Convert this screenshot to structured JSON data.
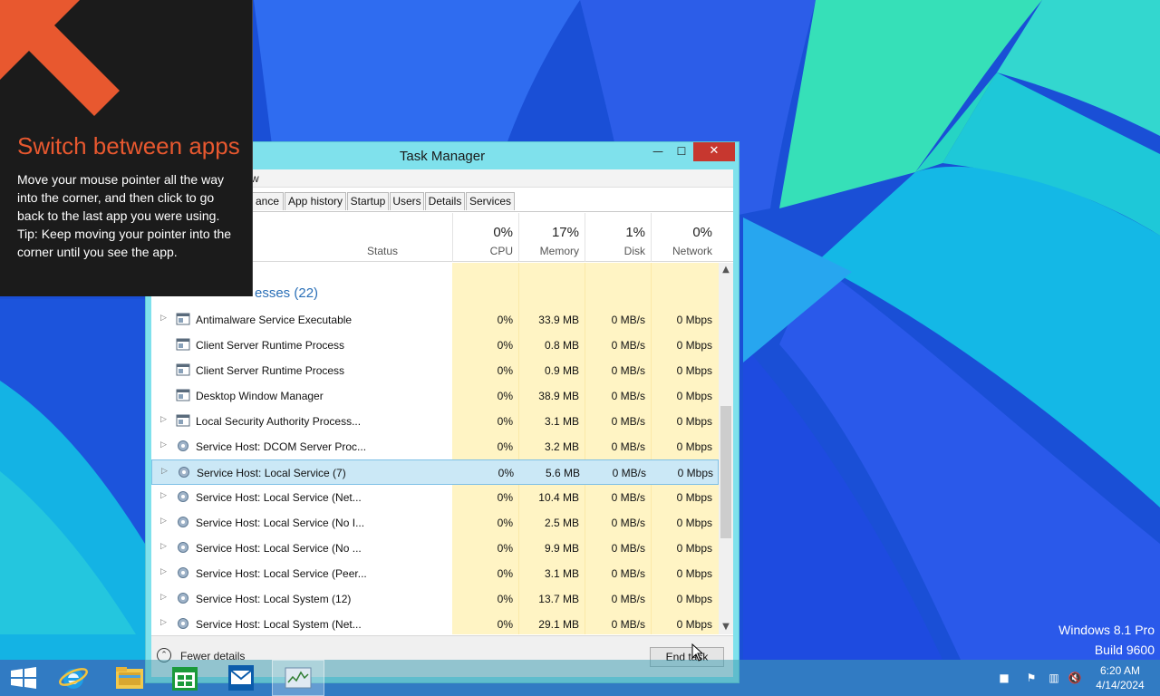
{
  "tip": {
    "title": "Switch between apps",
    "body_line1": "Move your mouse pointer all the way into the corner, and then click to go back to the last app you were using.",
    "body_line2": "Tip: Keep moving your pointer into the corner until you see the app.",
    "accent_color": "#e8582f"
  },
  "task_manager": {
    "title": "Task Manager",
    "menu_view": "w",
    "tabs": [
      "ance",
      "App history",
      "Startup",
      "Users",
      "Details",
      "Services"
    ],
    "columns": {
      "status": "Status",
      "cpu_pct": "0%",
      "cpu": "CPU",
      "memory_pct": "17%",
      "memory": "Memory",
      "disk_pct": "1%",
      "disk": "Disk",
      "network_pct": "0%",
      "network": "Network"
    },
    "group_header": "esses (22)",
    "rows": [
      {
        "name": "Antimalware Service Executable",
        "cpu": "0%",
        "memory": "33.9 MB",
        "disk": "0 MB/s",
        "network": "0 Mbps",
        "expandable": true,
        "icon": "window-icon"
      },
      {
        "name": "Client Server Runtime Process",
        "cpu": "0%",
        "memory": "0.8 MB",
        "disk": "0 MB/s",
        "network": "0 Mbps",
        "expandable": false,
        "icon": "window-icon"
      },
      {
        "name": "Client Server Runtime Process",
        "cpu": "0%",
        "memory": "0.9 MB",
        "disk": "0 MB/s",
        "network": "0 Mbps",
        "expandable": false,
        "icon": "window-icon"
      },
      {
        "name": "Desktop Window Manager",
        "cpu": "0%",
        "memory": "38.9 MB",
        "disk": "0 MB/s",
        "network": "0 Mbps",
        "expandable": false,
        "icon": "window-icon"
      },
      {
        "name": "Local Security Authority Process...",
        "cpu": "0%",
        "memory": "3.1 MB",
        "disk": "0 MB/s",
        "network": "0 Mbps",
        "expandable": true,
        "icon": "window-icon"
      },
      {
        "name": "Service Host: DCOM Server Proc...",
        "cpu": "0%",
        "memory": "3.2 MB",
        "disk": "0 MB/s",
        "network": "0 Mbps",
        "expandable": true,
        "icon": "gear-icon"
      },
      {
        "name": "Service Host: Local Service (7)",
        "cpu": "0%",
        "memory": "5.6 MB",
        "disk": "0 MB/s",
        "network": "0 Mbps",
        "expandable": true,
        "icon": "gear-icon",
        "selected": true
      },
      {
        "name": "Service Host: Local Service (Net...",
        "cpu": "0%",
        "memory": "10.4 MB",
        "disk": "0 MB/s",
        "network": "0 Mbps",
        "expandable": true,
        "icon": "gear-icon"
      },
      {
        "name": "Service Host: Local Service (No I...",
        "cpu": "0%",
        "memory": "2.5 MB",
        "disk": "0 MB/s",
        "network": "0 Mbps",
        "expandable": true,
        "icon": "gear-icon"
      },
      {
        "name": "Service Host: Local Service (No ...",
        "cpu": "0%",
        "memory": "9.9 MB",
        "disk": "0 MB/s",
        "network": "0 Mbps",
        "expandable": true,
        "icon": "gear-icon"
      },
      {
        "name": "Service Host: Local Service (Peer...",
        "cpu": "0%",
        "memory": "3.1 MB",
        "disk": "0 MB/s",
        "network": "0 Mbps",
        "expandable": true,
        "icon": "gear-icon"
      },
      {
        "name": "Service Host: Local System (12)",
        "cpu": "0%",
        "memory": "13.7 MB",
        "disk": "0 MB/s",
        "network": "0 Mbps",
        "expandable": true,
        "icon": "gear-icon"
      },
      {
        "name": "Service Host: Local System (Net...",
        "cpu": "0%",
        "memory": "29.1 MB",
        "disk": "0 MB/s",
        "network": "0 Mbps",
        "expandable": true,
        "icon": "gear-icon"
      }
    ],
    "fewer_details": "Fewer details",
    "end_task": "End task"
  },
  "watermark": {
    "line1": "Windows 8.1 Pro",
    "line2": "Build 9600"
  },
  "taskbar": {
    "apps": [
      "windows-start-icon",
      "internet-explorer-icon",
      "file-explorer-icon",
      "store-icon",
      "mail-icon",
      "task-manager-icon"
    ],
    "clock_time": "6:20 AM",
    "clock_date": "4/14/2024"
  }
}
